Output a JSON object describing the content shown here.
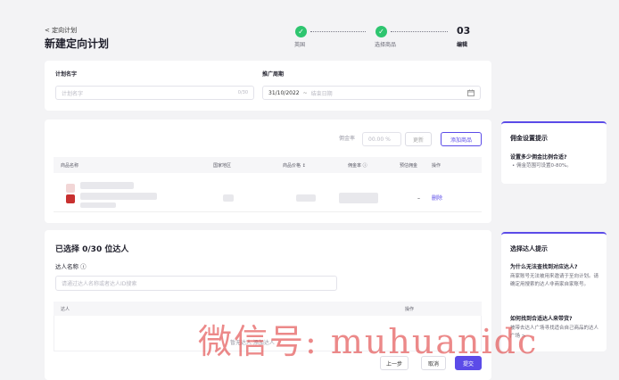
{
  "header": {
    "back_link": "< 定向计划",
    "title": "新建定向计划",
    "steps": [
      {
        "label": "英国",
        "state": "done"
      },
      {
        "label": "选择商品",
        "state": "done"
      },
      {
        "number": "03",
        "label": "编辑",
        "state": "current"
      }
    ]
  },
  "plan_card": {
    "name_label": "计划名字",
    "name_placeholder": "计划名字",
    "name_counter": "0/30",
    "period_label": "推广周期",
    "start_date": "31/10/2022",
    "separator": "~",
    "end_placeholder": "结束日期"
  },
  "products_card": {
    "commission_label": "佣金率",
    "commission_value": "00.00 %",
    "update_button": "更新",
    "add_button": "添加商品",
    "columns": [
      "商品名称",
      "国家地区",
      "商品价格 ↕",
      "佣金率 ⓘ",
      "预估佣金",
      "操作"
    ],
    "row": {
      "estimated": "–",
      "action": "删除"
    }
  },
  "creators_card": {
    "title": "已选择 0/30 位达人",
    "name_label": "达人名称 ⓘ",
    "search_placeholder": "请通过达人名称或者达人ID搜索",
    "columns": [
      "达人",
      "操作"
    ],
    "empty_text": "暂无达人 添加达人"
  },
  "footer": {
    "prev_button": "上一步",
    "cancel_button": "取消",
    "submit_button": "提交"
  },
  "commission_tip": {
    "title": "佣金设置提示",
    "question": "设置多少佣金比例合适?",
    "bullet": "佣金范围可设置0-80%。"
  },
  "creator_tip": {
    "title": "选择达人提示",
    "q1": "为什么无法查找到对应达人?",
    "a1": "商家账号无法被用来邀请于至向计划。请确定用搜索的达人非商家自家账号。",
    "q2": "如何找到合适达人来带货?",
    "a2": "被带去达人广场寻找适合自己商品的达人广场 >"
  },
  "watermark": "微信号: muhuanidc",
  "colors": {
    "accent": "#5b4be8",
    "success": "#2ec56f",
    "danger_red": "#c8302f"
  }
}
